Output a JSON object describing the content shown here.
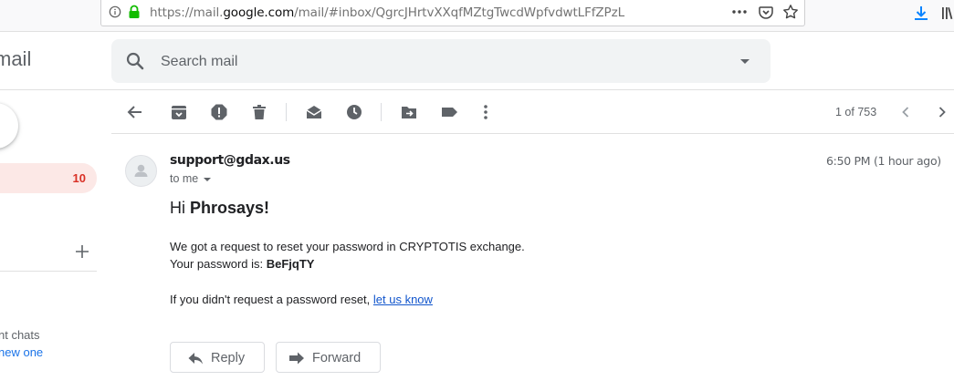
{
  "browser": {
    "url_prefix": "https://mail.",
    "url_domain": "google.com",
    "url_path": "/mail/#inbox/QgrcJHrtvXXqfMZtgTwcdWpfvdwtLFfZPzL"
  },
  "app": {
    "logo_text": "mail"
  },
  "search": {
    "placeholder": "Search mail"
  },
  "sidebar": {
    "inbox_count": "10",
    "hangouts_text": "nt chats",
    "hangouts_link": "new one"
  },
  "toolbar": {
    "page_count": "1 of 753"
  },
  "message": {
    "sender": "support@gdax.us",
    "recipient_label": "to me",
    "time": "6:50 PM (1 hour ago)",
    "greeting_prefix": "Hi ",
    "greeting_name": "Phrosays!",
    "line1": "We got a request to reset your password in CRYPTOTIS exchange.",
    "line2_prefix": "Your password is: ",
    "line2_password": "BeFjqTY",
    "line3_prefix": "If you didn't request a password reset, ",
    "line3_link": "let us know"
  },
  "actions": {
    "reply_label": "Reply",
    "forward_label": "Forward"
  },
  "colors": {
    "accent_red": "#d93025",
    "link_blue": "#1155cc",
    "lock_green": "#12bc00",
    "download_blue": "#0a84ff"
  }
}
